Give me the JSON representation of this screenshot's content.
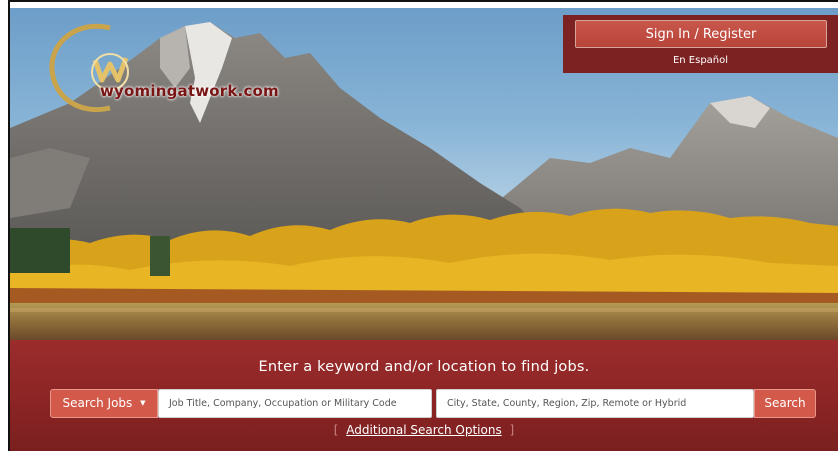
{
  "logo": {
    "text": "wyomingatwork.com"
  },
  "header": {
    "signin_label": "Sign In / Register",
    "language_link": "En Español"
  },
  "search": {
    "heading": "Enter a keyword and/or location to find jobs.",
    "type_label": "Search",
    "type_value": "Jobs",
    "caret": "▼",
    "keyword_placeholder": "Job Title, Company, Occupation or Military Code",
    "location_placeholder": "City, State, County, Region, Zip, Remote or Hybrid",
    "submit_label": "Search",
    "advanced_bracket_open": "[",
    "advanced_link": "Additional Search Options",
    "advanced_bracket_close": "]"
  },
  "colors": {
    "brand_red": "#8a2424",
    "button_red": "#d35a4b",
    "panel_red": "#7d2222"
  }
}
